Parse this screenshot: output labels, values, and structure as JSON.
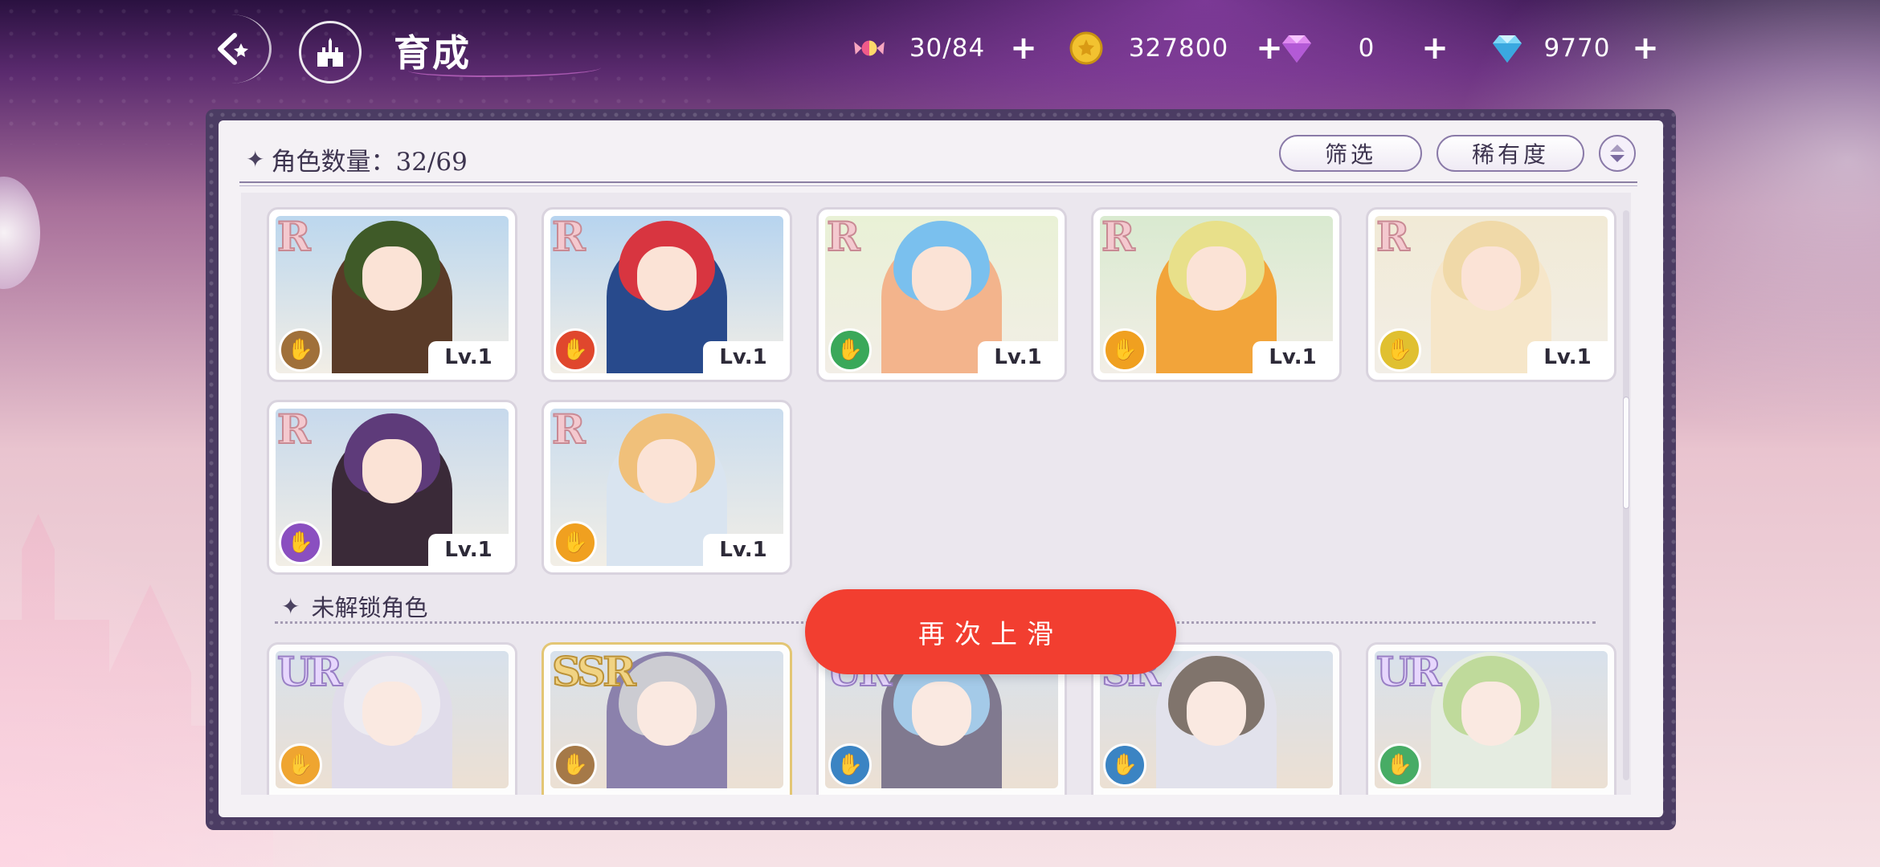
{
  "header": {
    "title": "育成",
    "back_icon": "back-arrow-icon",
    "home_icon": "castle-icon"
  },
  "currencies": [
    {
      "name": "candy",
      "icon": "candy-icon",
      "value": "30/84"
    },
    {
      "name": "coin",
      "icon": "coin-icon",
      "value": "327800"
    },
    {
      "name": "pink_gem",
      "icon": "pink-gem-icon",
      "value": "0"
    },
    {
      "name": "blue_gem",
      "icon": "blue-gem-icon",
      "value": "9770"
    }
  ],
  "panel": {
    "count_label": "角色数量：32/69",
    "filter_label": "筛选",
    "rarity_label": "稀有度",
    "sort_icon": "sort-toggle-icon"
  },
  "owned_characters": [
    {
      "rarity": "R",
      "level": "Lv.1",
      "class_color": "#a0703a",
      "hair": "#3f5a28",
      "outfit": "#5a3b28",
      "sky": "#bcd7ee"
    },
    {
      "rarity": "R",
      "level": "Lv.1",
      "class_color": "#e0472d",
      "hair": "#d83540",
      "outfit": "#284a8c",
      "sky": "#b7d4ef"
    },
    {
      "rarity": "R",
      "level": "Lv.1",
      "class_color": "#3aa85a",
      "hair": "#7ac0ee",
      "outfit": "#f3b48c",
      "sky": "#e9f1d6"
    },
    {
      "rarity": "R",
      "level": "Lv.1",
      "class_color": "#f0a020",
      "hair": "#e8e08a",
      "outfit": "#f2a43a",
      "sky": "#d9ead0"
    },
    {
      "rarity": "R",
      "level": "Lv.1",
      "class_color": "#e0c030",
      "hair": "#f0d9a8",
      "outfit": "#f6e6c9",
      "sky": "#f1ead6"
    },
    {
      "rarity": "R",
      "level": "Lv.1",
      "class_color": "#8a4fc0",
      "hair": "#5e3b7a",
      "outfit": "#3a2a38",
      "sky": "#c7d9ec"
    },
    {
      "rarity": "R",
      "level": "Lv.1",
      "class_color": "#f0a020",
      "hair": "#f0c07a",
      "outfit": "#d9e4f0",
      "sky": "#c9dcee"
    }
  ],
  "locked_section": {
    "label": "未解锁角色"
  },
  "locked_characters": [
    {
      "rarity": "UR",
      "class_color": "#f0a020",
      "hair": "#e9e6ee",
      "outfit": "#d6d0e3"
    },
    {
      "rarity": "SSR",
      "class_color": "#a0703a",
      "hair": "#b8b8c0",
      "outfit": "#5a4c8a"
    },
    {
      "rarity": "UR",
      "class_color": "#2d7cc0",
      "hair": "#7fb6e0",
      "outfit": "#4a4060"
    },
    {
      "rarity": "SR",
      "class_color": "#2d7cc0",
      "hair": "#4a3a2e",
      "outfit": "#d9d9e6"
    },
    {
      "rarity": "UR",
      "class_color": "#3aa85a",
      "hair": "#a6cc72",
      "outfit": "#dde7d6"
    }
  ],
  "toast": {
    "text": "再次上滑"
  },
  "colors": {
    "toast_red": "#f23e30",
    "panel_frame": "#4b3c63"
  }
}
